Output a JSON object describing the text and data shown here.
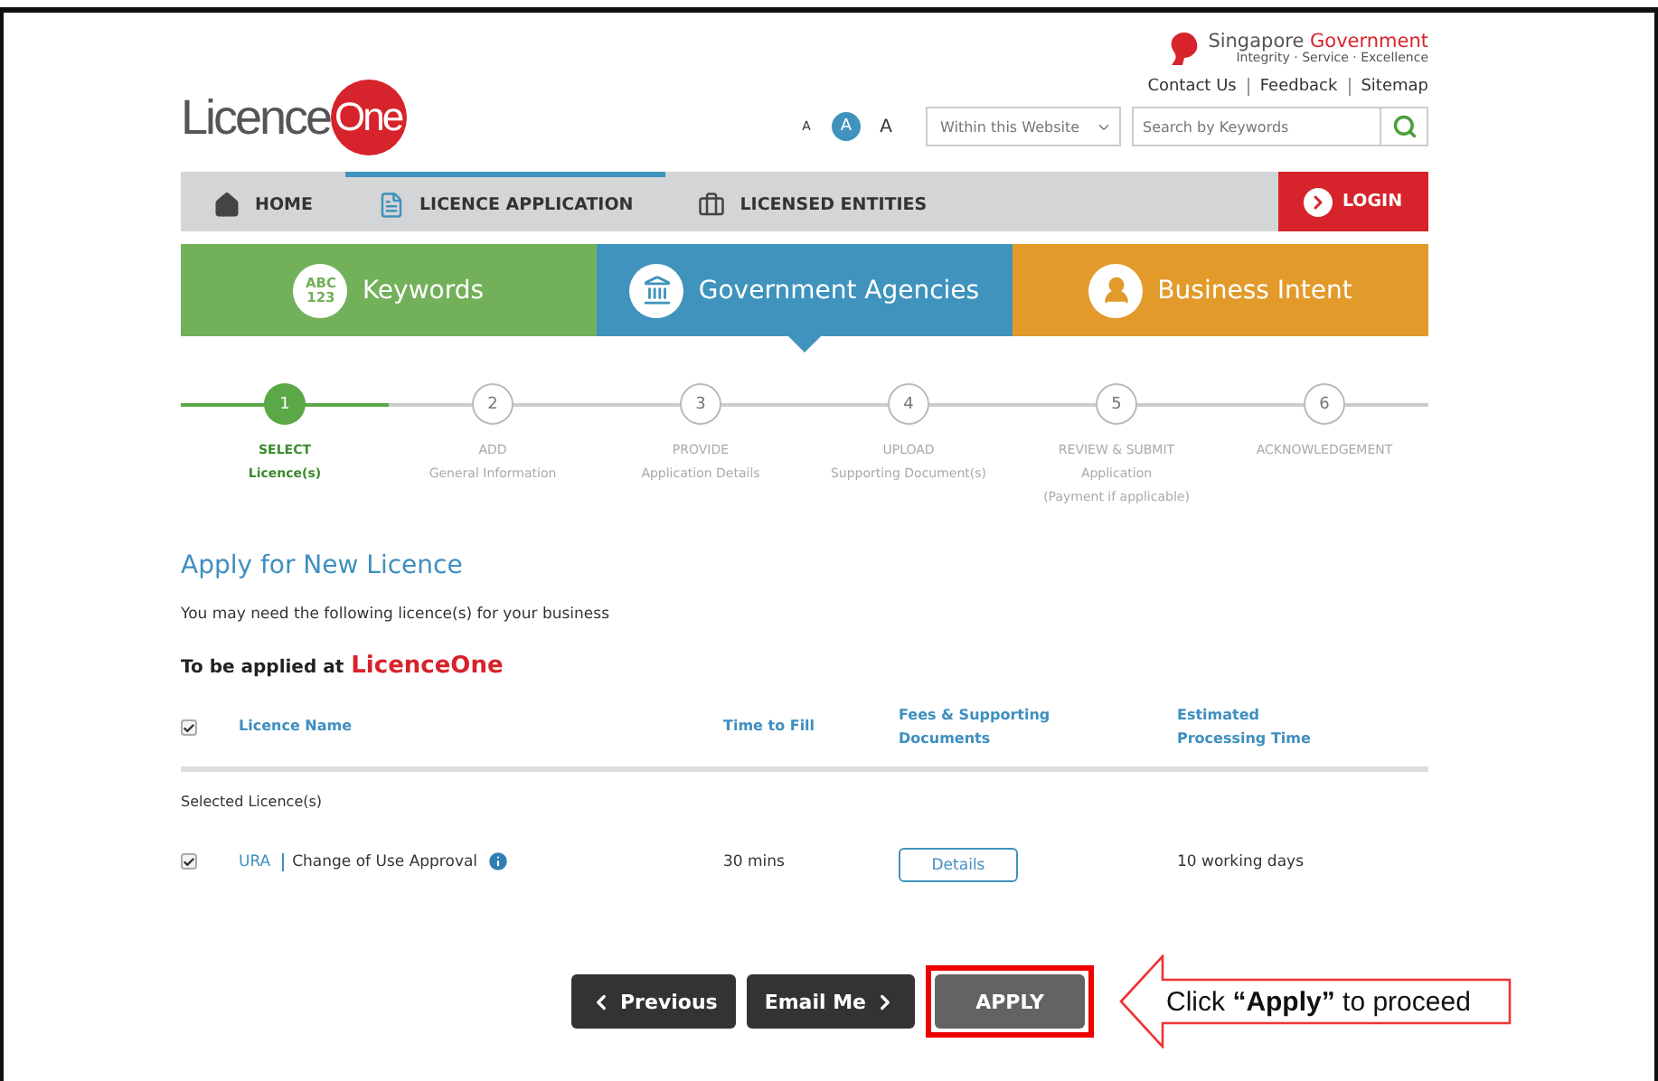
{
  "logo": {
    "word": "Licence",
    "badge": "One"
  },
  "government": {
    "name": "Singapore",
    "name_accent": "Government",
    "motto": "Integrity · Service · Excellence"
  },
  "top_links": [
    "Contact Us",
    "Feedback",
    "Sitemap"
  ],
  "font_sizes": [
    {
      "label": "A",
      "selected": false
    },
    {
      "label": "A",
      "selected": true
    },
    {
      "label": "A",
      "selected": false
    }
  ],
  "search": {
    "scope": "Within this Website",
    "placeholder": "Search by Keywords"
  },
  "nav": [
    {
      "label": "HOME",
      "kind": "home",
      "selected": false
    },
    {
      "label": "LICENCE APPLICATION",
      "kind": "document",
      "selected": true
    },
    {
      "label": "LICENSED ENTITIES",
      "kind": "briefcase",
      "selected": false
    }
  ],
  "login": "LOGIN",
  "categories": [
    {
      "label": "Keywords",
      "kind": "text-badge",
      "badge_lines": [
        "ABC",
        "123"
      ],
      "color": "#72b05a",
      "selected": false
    },
    {
      "label": "Government Agencies",
      "kind": "building",
      "color": "#3f93bd",
      "selected": true
    },
    {
      "label": "Business Intent",
      "kind": "person",
      "color": "#e29a2a",
      "selected": false
    }
  ],
  "steps": [
    {
      "number": "1",
      "title": "SELECT",
      "subtitle": [
        "Licence(s)"
      ],
      "current": true
    },
    {
      "number": "2",
      "title": "ADD",
      "subtitle": [
        "General Information"
      ],
      "current": false
    },
    {
      "number": "3",
      "title": "PROVIDE",
      "subtitle": [
        "Application Details"
      ],
      "current": false
    },
    {
      "number": "4",
      "title": "UPLOAD",
      "subtitle": [
        "Supporting Document(s)"
      ],
      "current": false
    },
    {
      "number": "5",
      "title": "REVIEW & SUBMIT",
      "subtitle": [
        "Application",
        "(Payment if applicable)"
      ],
      "current": false
    },
    {
      "number": "6",
      "title": "ACKNOWLEDGEMENT",
      "current": false
    }
  ],
  "heading": "Apply for New Licence",
  "intro": "You may need the following licence(s) for your business",
  "applied_at": {
    "label": "To be applied at",
    "brand": "LicenceOne"
  },
  "table": {
    "select_all_checked": true,
    "columns": [
      "Licence Name",
      "Time to Fill",
      "Fees & Supporting Documents",
      "Estimated Processing Time"
    ],
    "section": "Selected Licence(s)",
    "rows": [
      {
        "checked": true,
        "agency": "URA",
        "name": "Change of Use Approval",
        "time": "30 mins",
        "action": "Details",
        "processing": "10 working days"
      }
    ]
  },
  "buttons": [
    {
      "label": "Previous",
      "kind": "back",
      "highlighted": false
    },
    {
      "label": "Email Me",
      "kind": "forward",
      "highlighted": false
    },
    {
      "label": "APPLY",
      "kind": "primary",
      "highlighted": true
    }
  ],
  "callout": "Click **“Apply”** to proceed"
}
